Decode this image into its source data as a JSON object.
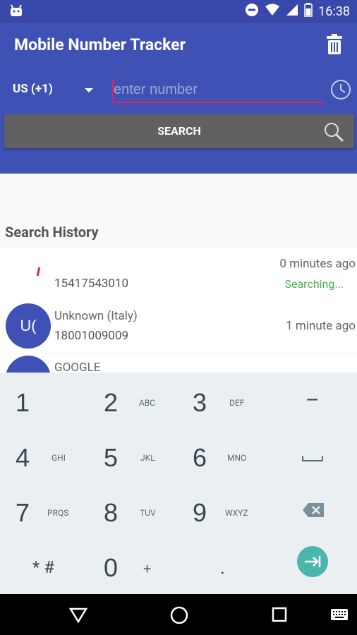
{
  "status_bar": {
    "time": "16:38"
  },
  "app_bar": {
    "title": "Mobile Number Tracker"
  },
  "search": {
    "country": "US (+1)",
    "placeholder": "enter number",
    "button_label": "SEARCH"
  },
  "history": {
    "title": "Search History",
    "items": [
      {
        "name": "",
        "number": "15417543010",
        "time": "0 minutes ago",
        "status": "Searching..."
      },
      {
        "avatar": "U(",
        "name": "Unknown (Italy)",
        "number": "18001009009",
        "time": "1 minute ago",
        "status": ""
      },
      {
        "name": "GOOGLE"
      }
    ]
  },
  "keypad": {
    "keys": [
      {
        "digit": "1",
        "letters": ""
      },
      {
        "digit": "2",
        "letters": "ABC"
      },
      {
        "digit": "3",
        "letters": "DEF"
      },
      {
        "digit": "4",
        "letters": "GHI"
      },
      {
        "digit": "5",
        "letters": "JKL"
      },
      {
        "digit": "6",
        "letters": "MNO"
      },
      {
        "digit": "7",
        "letters": "PRQS"
      },
      {
        "digit": "8",
        "letters": "TUV"
      },
      {
        "digit": "9",
        "letters": "WXYZ"
      },
      {
        "digit": "* #",
        "letters": ""
      },
      {
        "digit": "0",
        "letters": "+"
      },
      {
        "digit": ".",
        "letters": ""
      }
    ],
    "dash": "–"
  },
  "colors": {
    "primary": "#3f51b5",
    "status_bar": "#3949ab",
    "accent": "#e91e63",
    "search_button": "#616161",
    "searching": "#4caf50",
    "keypad_bg": "#eceff1",
    "go_button": "#4db6ac"
  }
}
